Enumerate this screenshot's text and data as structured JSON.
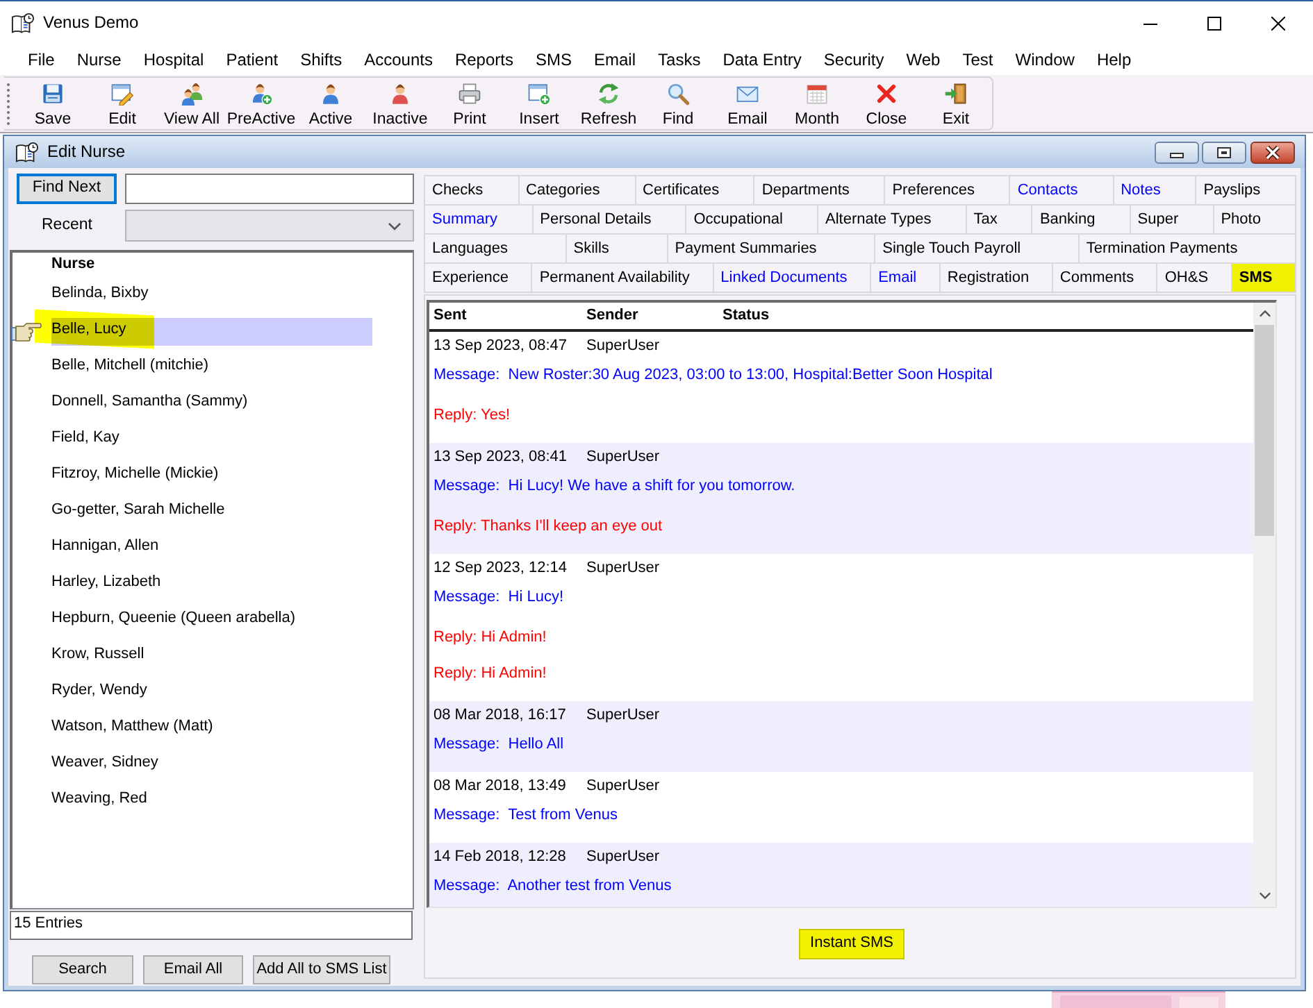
{
  "window": {
    "title": "Venus Demo"
  },
  "menu": [
    "File",
    "Nurse",
    "Hospital",
    "Patient",
    "Shifts",
    "Accounts",
    "Reports",
    "SMS",
    "Email",
    "Tasks",
    "Data Entry",
    "Security",
    "Web",
    "Test",
    "Window",
    "Help"
  ],
  "toolbar": [
    {
      "kind": "save",
      "label": "Save"
    },
    {
      "kind": "edit",
      "label": "Edit"
    },
    {
      "kind": "group",
      "label": "View All"
    },
    {
      "kind": "adduser",
      "label": "PreActive"
    },
    {
      "kind": "user",
      "label": "Active"
    },
    {
      "kind": "inactive",
      "label": "Inactive"
    },
    {
      "kind": "print",
      "label": "Print"
    },
    {
      "kind": "insert",
      "label": "Insert"
    },
    {
      "kind": "refresh",
      "label": "Refresh"
    },
    {
      "kind": "find",
      "label": "Find"
    },
    {
      "kind": "email",
      "label": "Email"
    },
    {
      "kind": "month",
      "label": "Month"
    },
    {
      "kind": "close",
      "label": "Close"
    },
    {
      "kind": "exit",
      "label": "Exit"
    }
  ],
  "child_window": {
    "title": "Edit Nurse"
  },
  "find": {
    "button": "Find Next"
  },
  "recent": {
    "label": "Recent",
    "disabled": true
  },
  "nurse_list": {
    "header": "Nurse",
    "items": [
      {
        "name": "Belinda, Bixby",
        "selected": false
      },
      {
        "name": "Belle, Lucy",
        "selected": true
      },
      {
        "name": "Belle, Mitchell (mitchie)",
        "selected": false
      },
      {
        "name": "Donnell, Samantha (Sammy)",
        "selected": false
      },
      {
        "name": "Field, Kay",
        "selected": false
      },
      {
        "name": "Fitzroy, Michelle (Mickie)",
        "selected": false
      },
      {
        "name": "Go-getter, Sarah Michelle",
        "selected": false
      },
      {
        "name": "Hannigan, Allen",
        "selected": false
      },
      {
        "name": "Harley, Lizabeth",
        "selected": false
      },
      {
        "name": "Hepburn, Queenie (Queen arabella)",
        "selected": false
      },
      {
        "name": "Krow, Russell",
        "selected": false
      },
      {
        "name": "Ryder, Wendy",
        "selected": false
      },
      {
        "name": "Watson, Matthew (Matt)",
        "selected": false
      },
      {
        "name": "Weaver, Sidney",
        "selected": false
      },
      {
        "name": "Weaving, Red",
        "selected": false
      }
    ]
  },
  "entries_count": "15 Entries",
  "left_buttons": [
    "Search",
    "Email All",
    "Add All to SMS List"
  ],
  "tab_rows": [
    [
      {
        "label": "Checks",
        "has_data": false,
        "selected": false
      },
      {
        "label": "Categories",
        "has_data": false,
        "selected": false
      },
      {
        "label": "Certificates",
        "has_data": false,
        "selected": false
      },
      {
        "label": "Departments",
        "has_data": false,
        "selected": false
      },
      {
        "label": "Preferences",
        "has_data": false,
        "selected": false
      },
      {
        "label": "Contacts",
        "has_data": true,
        "selected": false
      },
      {
        "label": "Notes",
        "has_data": true,
        "selected": false
      },
      {
        "label": "Payslips",
        "has_data": false,
        "selected": false
      }
    ],
    [
      {
        "label": "Summary",
        "has_data": true,
        "selected": false
      },
      {
        "label": "Personal Details",
        "has_data": false,
        "selected": false
      },
      {
        "label": "Occupational",
        "has_data": false,
        "selected": false
      },
      {
        "label": "Alternate Types",
        "has_data": false,
        "selected": false
      },
      {
        "label": "Tax",
        "has_data": false,
        "selected": false
      },
      {
        "label": "Banking",
        "has_data": false,
        "selected": false
      },
      {
        "label": "Super",
        "has_data": false,
        "selected": false
      },
      {
        "label": "Photo",
        "has_data": false,
        "selected": false
      }
    ],
    [
      {
        "label": "Languages",
        "has_data": false,
        "selected": false
      },
      {
        "label": "Skills",
        "has_data": false,
        "selected": false
      },
      {
        "label": "Payment Summaries",
        "has_data": false,
        "selected": false
      },
      {
        "label": "Single Touch Payroll",
        "has_data": false,
        "selected": false
      },
      {
        "label": "Termination Payments",
        "has_data": false,
        "selected": false
      }
    ],
    [
      {
        "label": "Experience",
        "has_data": false,
        "selected": false
      },
      {
        "label": "Permanent Availability",
        "has_data": false,
        "selected": false
      },
      {
        "label": "Linked Documents",
        "has_data": true,
        "selected": false
      },
      {
        "label": "Email",
        "has_data": true,
        "selected": false
      },
      {
        "label": "Registration",
        "has_data": false,
        "selected": false
      },
      {
        "label": "Comments",
        "has_data": false,
        "selected": false
      },
      {
        "label": "OH&S",
        "has_data": false,
        "selected": false
      },
      {
        "label": "SMS",
        "has_data": false,
        "selected": true
      }
    ]
  ],
  "sms_grid": {
    "columns": [
      "Sent",
      "Sender",
      "Status"
    ],
    "entries": [
      {
        "sent": "13 Sep 2023, 08:47",
        "sender": "SuperUser",
        "message": "Message:  New Roster:30 Aug 2023, 03:00 to 13:00, Hospital:Better Soon Hospital",
        "replies": [
          "Reply: Yes!"
        ]
      },
      {
        "sent": "13 Sep 2023, 08:41",
        "sender": "SuperUser",
        "message": "Message:  Hi Lucy! We have a shift for you tomorrow.",
        "replies": [
          "Reply: Thanks I'll keep an eye out"
        ]
      },
      {
        "sent": "12 Sep 2023, 12:14",
        "sender": "SuperUser",
        "message": "Message:  Hi Lucy!",
        "replies": [
          "Reply: Hi Admin!",
          "Reply: Hi Admin!"
        ]
      },
      {
        "sent": "08 Mar 2018, 16:17",
        "sender": "SuperUser",
        "message": "Message:  Hello All"
      },
      {
        "sent": "08 Mar 2018, 13:49",
        "sender": "SuperUser",
        "message": "Message:  Test from Venus"
      },
      {
        "sent": "14 Feb 2018, 12:28",
        "sender": "SuperUser",
        "message": "Message:  Another test from Venus"
      }
    ]
  },
  "instant_sms_button": {
    "label": "Instant SMS",
    "marked": true
  }
}
